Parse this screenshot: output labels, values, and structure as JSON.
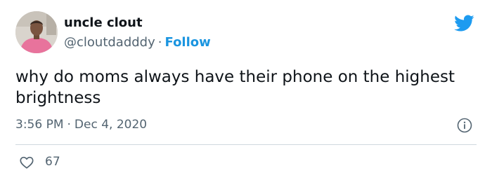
{
  "author": {
    "display_name": "uncle clout",
    "handle": "@cloutdadddy",
    "separator": "·",
    "follow_label": "Follow"
  },
  "tweet": {
    "text": "why do moms always have their phone on the highest brightness",
    "time": "3:56 PM",
    "separator": "·",
    "date": "Dec 4, 2020"
  },
  "engagement": {
    "likes": "67"
  },
  "icons": {
    "brand": "twitter-bird-icon",
    "info": "info-icon",
    "like": "heart-icon"
  },
  "colors": {
    "accent": "#1b95e0",
    "text": "#0f1419",
    "muted": "#536471",
    "divider": "#cfd9de",
    "avatar_shirt": "#e8739c"
  }
}
